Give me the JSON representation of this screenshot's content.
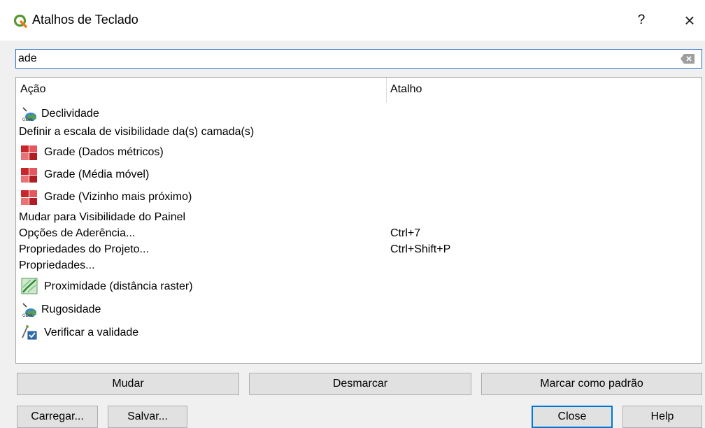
{
  "window": {
    "title": "Atalhos de Teclado",
    "help_label": "?",
    "close_glyph": "×"
  },
  "search": {
    "value": "ade",
    "clear_icon": "clear-text-icon"
  },
  "table": {
    "headers": {
      "action": "Ação",
      "shortcut": "Atalho"
    },
    "rows": [
      {
        "label": "Declividade",
        "shortcut": "",
        "icon": "terrain-slope-icon"
      },
      {
        "label": "Definir a escala de visibilidade da(s) camada(s)",
        "shortcut": "",
        "icon": ""
      },
      {
        "label": "Grade (Dados métricos)",
        "shortcut": "",
        "icon": "grid-raster-icon"
      },
      {
        "label": "Grade (Média móvel)",
        "shortcut": "",
        "icon": "grid-raster-icon"
      },
      {
        "label": "Grade (Vizinho mais próximo)",
        "shortcut": "",
        "icon": "grid-raster-icon"
      },
      {
        "label": "Mudar para Visibilidade do Painel",
        "shortcut": "",
        "icon": ""
      },
      {
        "label": "Opções de Aderência...",
        "shortcut": "Ctrl+7",
        "icon": ""
      },
      {
        "label": "Propriedades do Projeto...",
        "shortcut": "Ctrl+Shift+P",
        "icon": ""
      },
      {
        "label": "Propriedades...",
        "shortcut": "",
        "icon": ""
      },
      {
        "label": "Proximidade (distância raster)",
        "shortcut": "",
        "icon": "proximity-raster-icon"
      },
      {
        "label": "Rugosidade",
        "shortcut": "",
        "icon": "terrain-roughness-icon"
      },
      {
        "label": "Verificar a validade",
        "shortcut": "",
        "icon": "check-validity-icon"
      }
    ]
  },
  "buttons": {
    "change": "Mudar",
    "clear": "Desmarcar",
    "set_default": "Marcar como padrão",
    "load": "Carregar...",
    "save": "Salvar...",
    "close": "Close",
    "help": "Help"
  },
  "colors": {
    "accent": "#0078d7",
    "search_border": "#2b6fc9",
    "qgis_green": "#589632"
  }
}
